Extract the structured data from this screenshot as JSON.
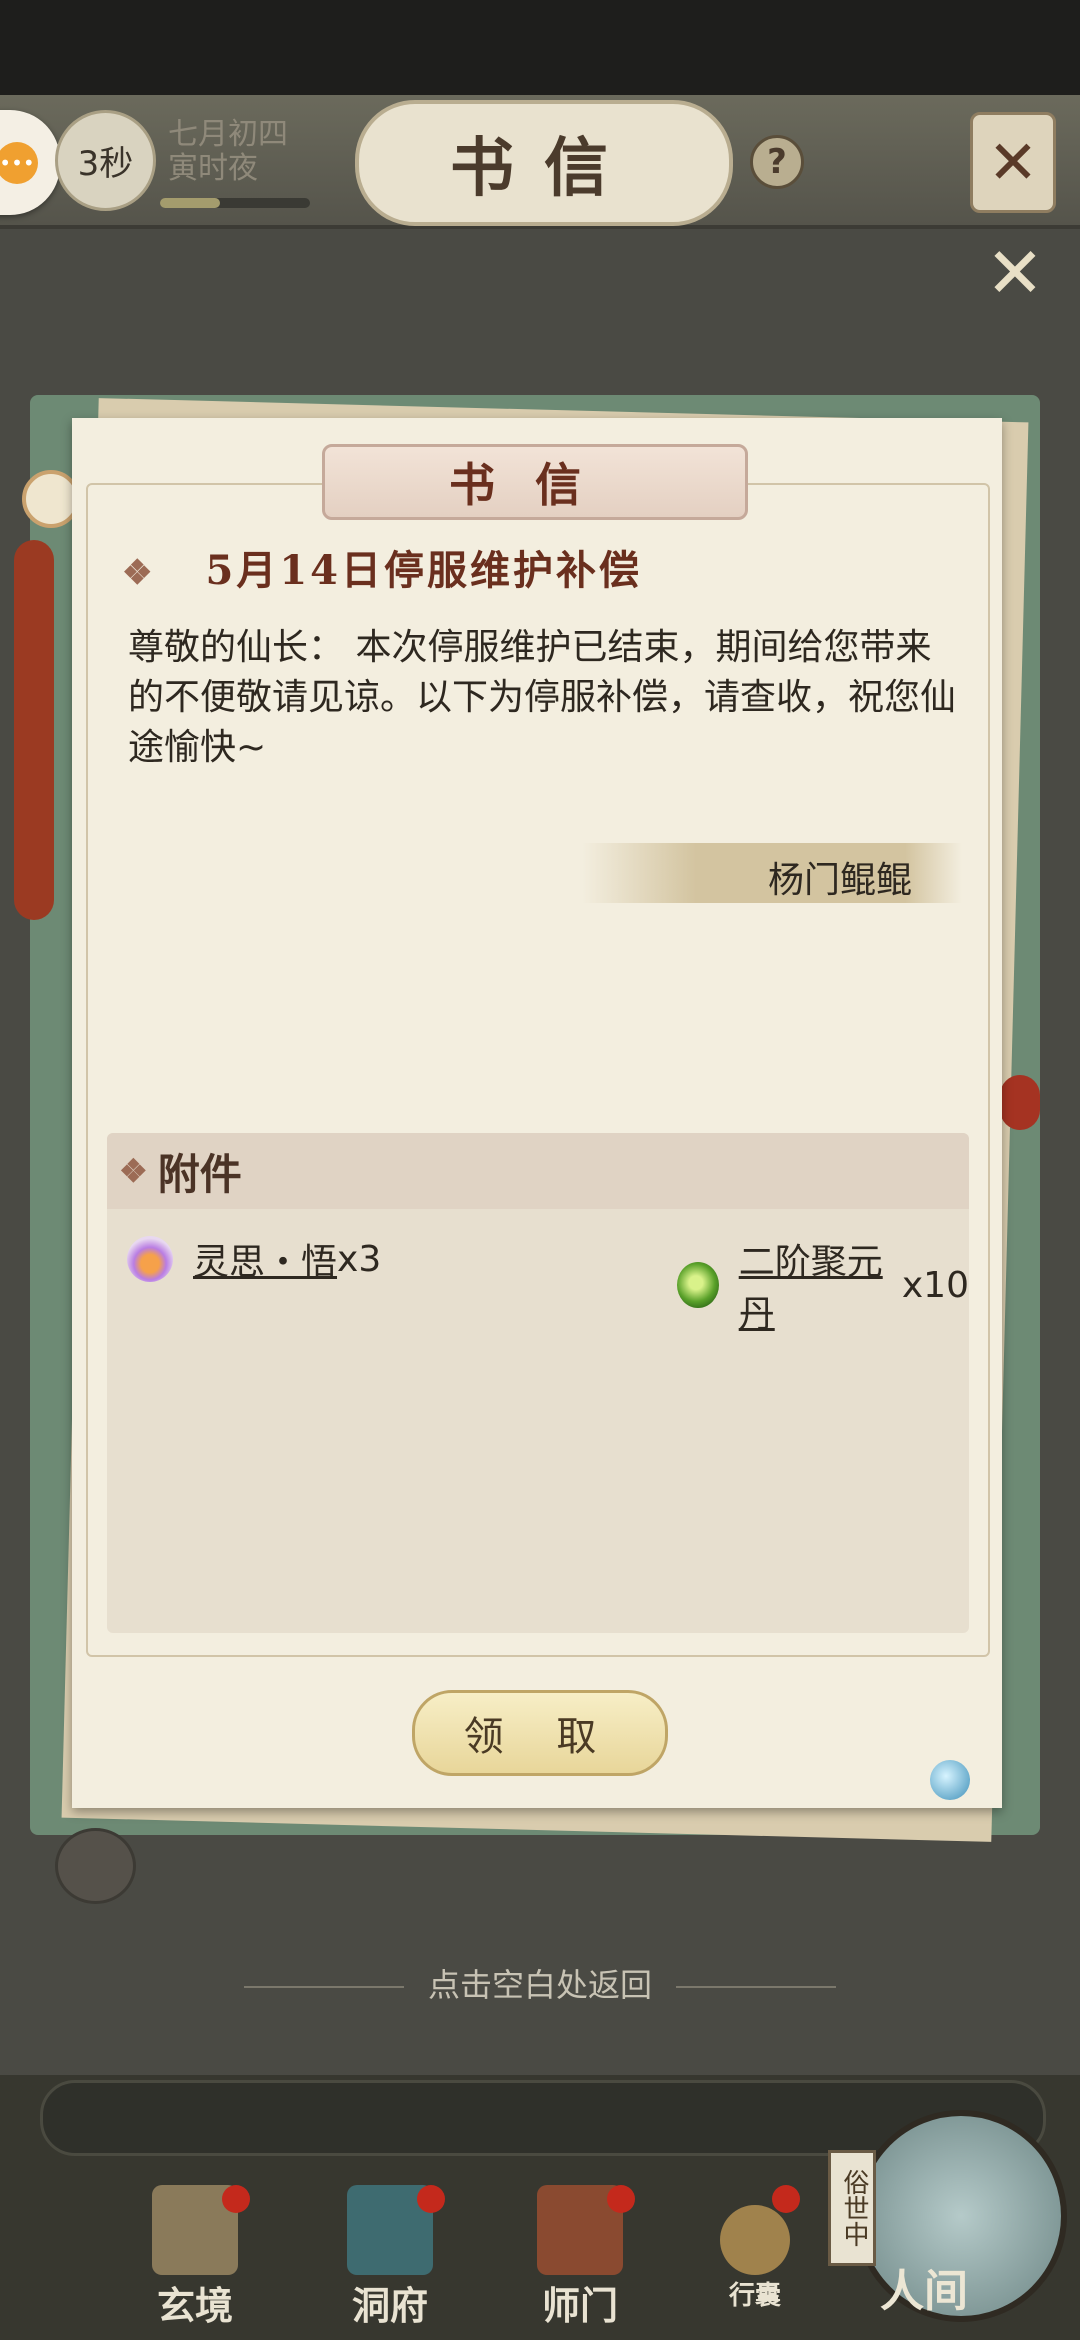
{
  "timer": {
    "countdown": "3秒"
  },
  "lunar_date": {
    "line1": "七月初四",
    "line2": "寅时夜"
  },
  "header": {
    "title": "书信",
    "help": "?"
  },
  "letter": {
    "plaque": "书信",
    "subject": "5月14日停服维护补偿",
    "body": "尊敬的仙长： 本次停服维护已结束，期间给您带来的不便敬请见谅。以下为停服补偿，请查收，祝您仙途愉快~",
    "sender": "杨门鲲鲲"
  },
  "attachments": {
    "heading": "附件",
    "items": [
      {
        "name": "灵思・悟",
        "qty": "x3",
        "icon": "flame-orb-icon",
        "color": "#b97de3"
      },
      {
        "name": "二阶聚元丹",
        "qty": "x10",
        "icon": "green-pill-icon",
        "color": "#5aa12a"
      }
    ]
  },
  "claim_button": "领 取",
  "hint": "点击空白处返回",
  "bottom_nav": [
    {
      "label": "玄境"
    },
    {
      "label": "洞府"
    },
    {
      "label": "师门"
    },
    {
      "label": "行囊"
    },
    {
      "label": "人间",
      "tag": "俗世中"
    }
  ]
}
